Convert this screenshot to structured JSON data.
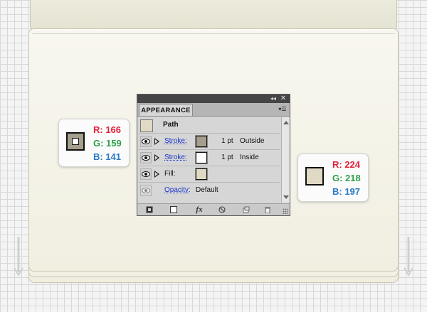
{
  "panel": {
    "tab_label": "APPEARANCE",
    "collapse_icon": "double-chevron-icon",
    "close_icon": "close-icon",
    "menu_icon": "panel-menu-icon",
    "object_label": "Path",
    "rows": [
      {
        "label": "Stroke:",
        "weight": "1 pt",
        "align": "Outside",
        "swatch_color": "#a69f8d"
      },
      {
        "label": "Stroke:",
        "weight": "1 pt",
        "align": "Inside",
        "swatch_color": "#ffffff"
      },
      {
        "label": "Fill:",
        "swatch_color": "#e0dac5"
      },
      {
        "label": "Opacity:",
        "value": "Default"
      }
    ],
    "footer_icons": [
      "add-new-stroke-icon",
      "add-new-fill-icon",
      "add-new-effect-fx-icon",
      "clear-appearance-icon",
      "duplicate-item-icon",
      "delete-item-icon"
    ],
    "fx_label": "fx"
  },
  "left_card": {
    "r": "R: 166",
    "g": "G: 159",
    "b": "B: 141",
    "color": "#a69f8d"
  },
  "right_card": {
    "r": "R: 224",
    "g": "G: 218",
    "b": "B: 197",
    "color": "#e0dac5"
  },
  "colors": {
    "red_text": "#e3223b",
    "green_text": "#2ea04a",
    "blue_text": "#2a79c7",
    "paper": "#f4f2e6"
  }
}
